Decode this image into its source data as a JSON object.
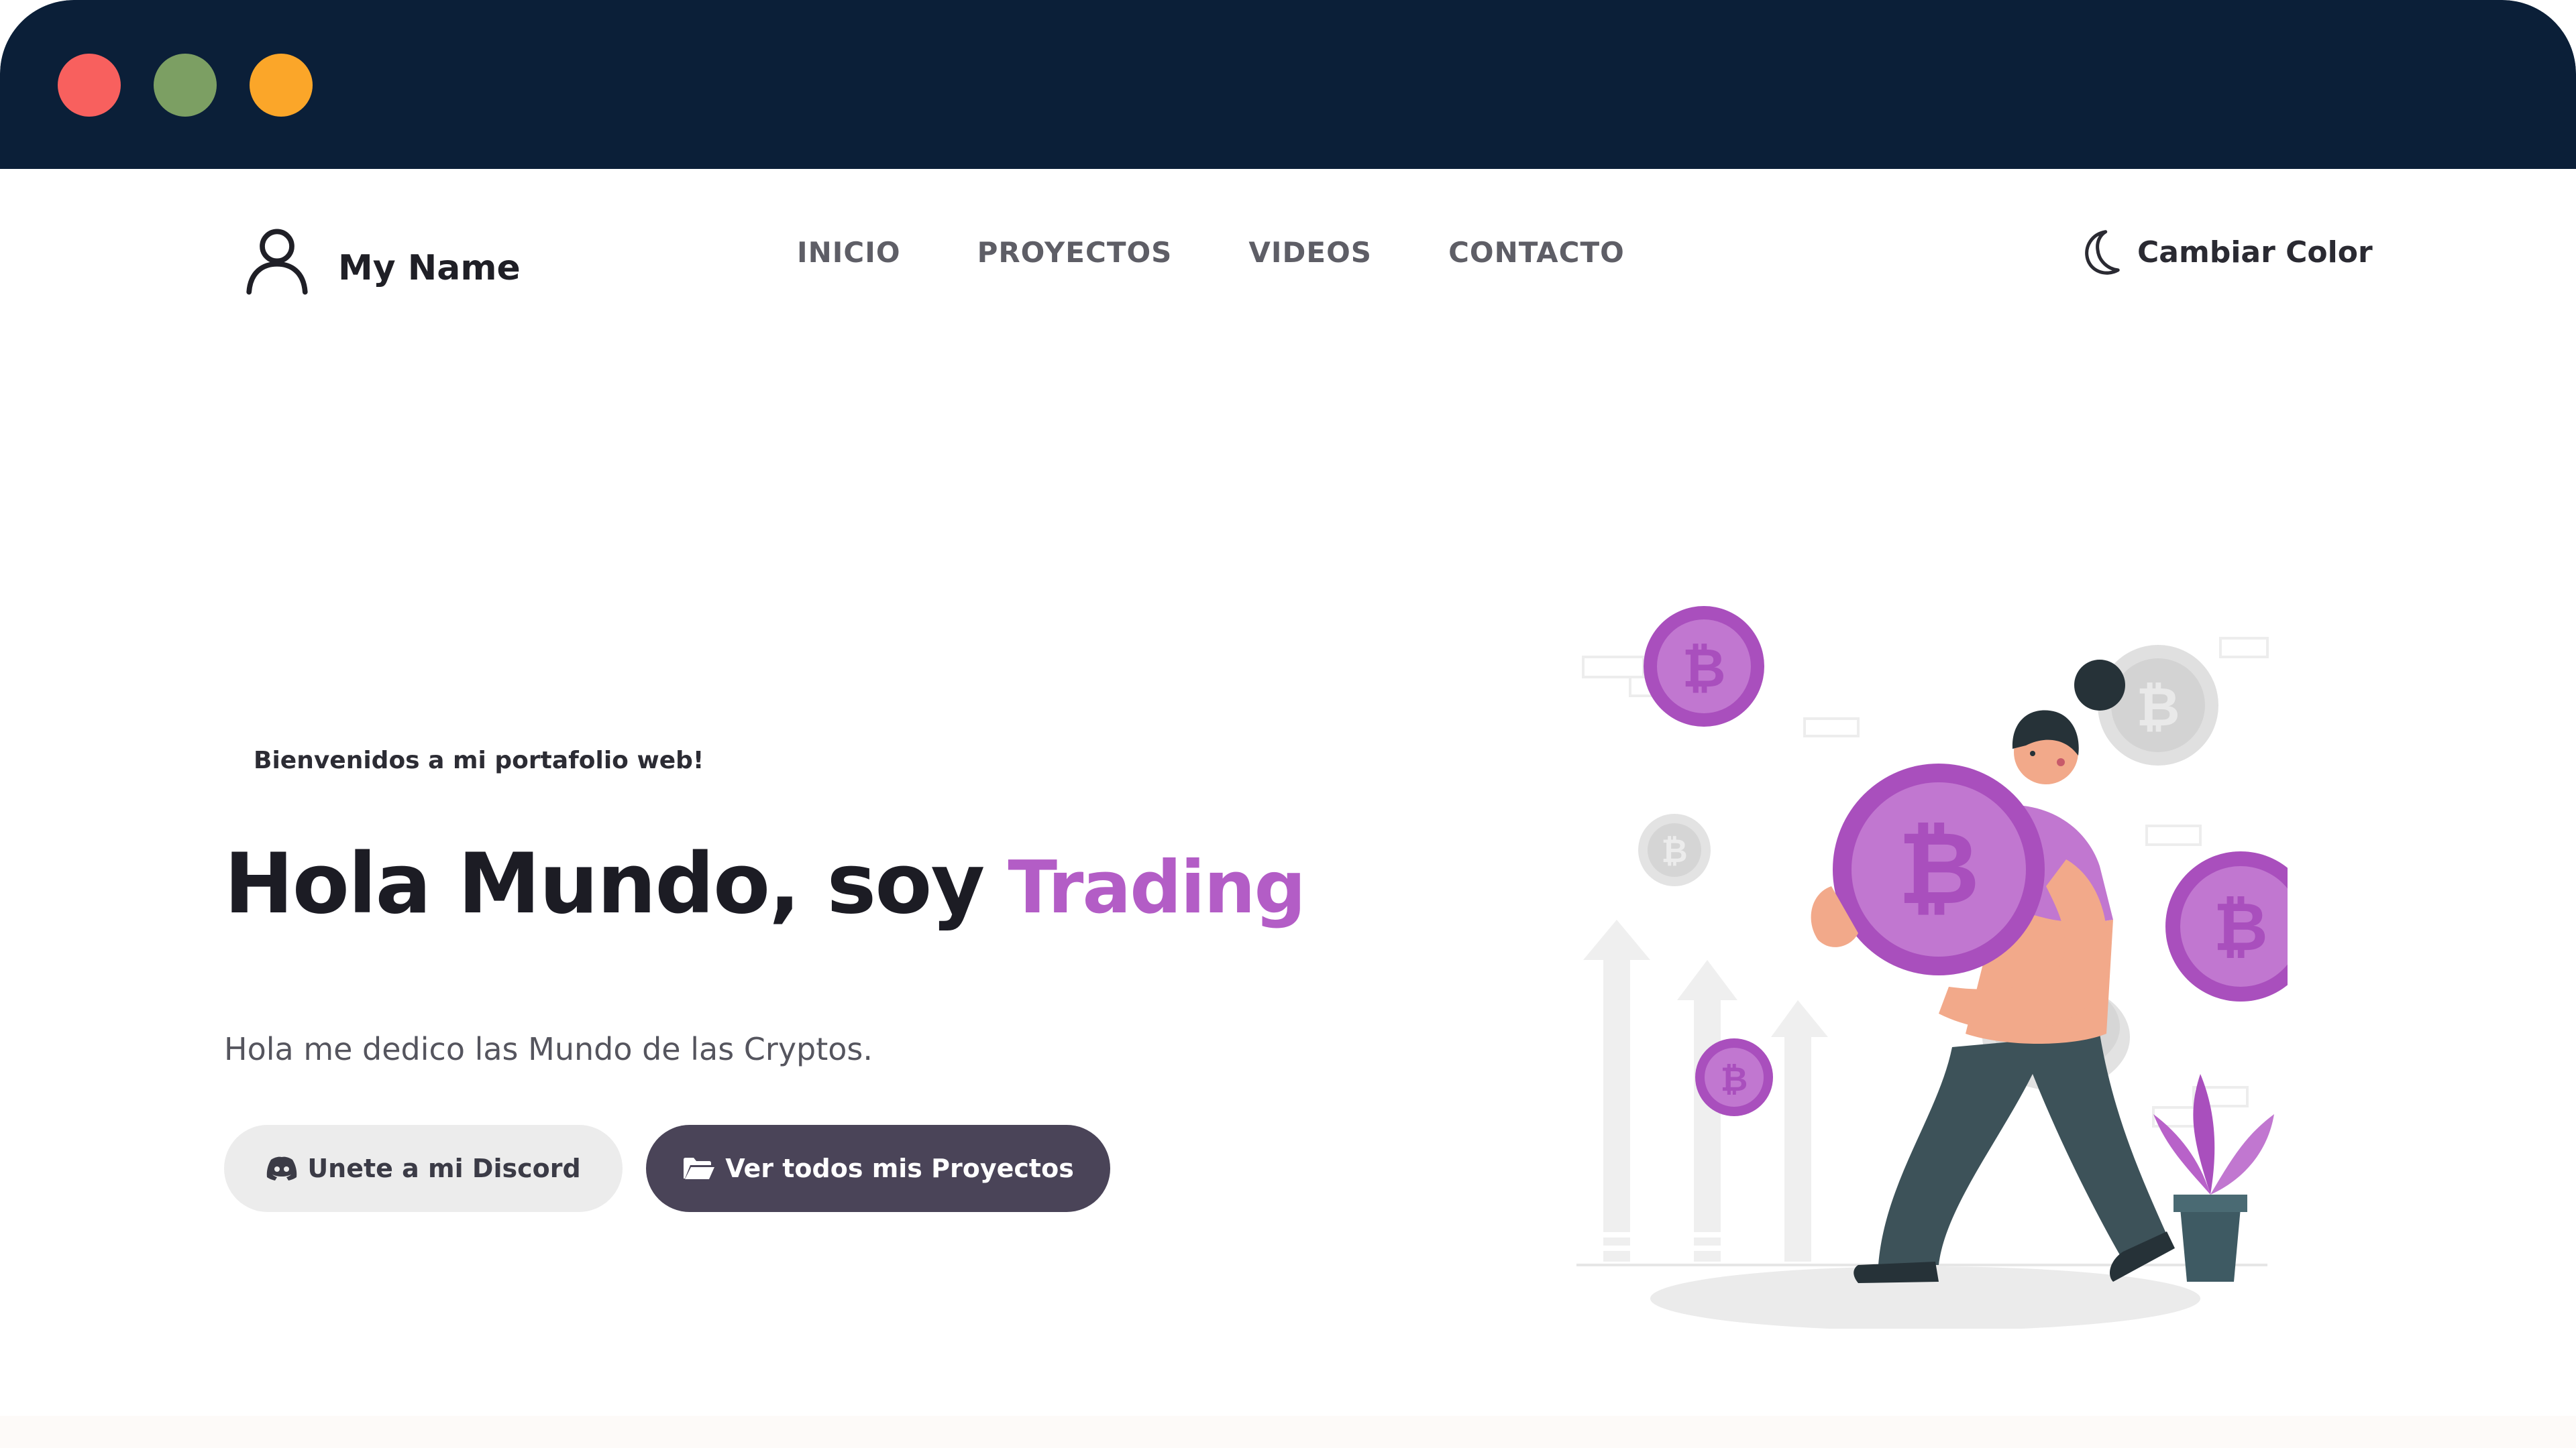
{
  "window": {
    "titlebar_color": "#0b1f38",
    "controls": [
      "close",
      "minimize",
      "maximize"
    ]
  },
  "header": {
    "brand_name": "My Name",
    "nav": [
      "INICIO",
      "PROYECTOS",
      "VIDEOS",
      "CONTACTO"
    ],
    "theme_toggle_label": "Cambiar Color"
  },
  "hero": {
    "welcome": "Bienvenidos a mi portafolio web!",
    "title": "Hola Mundo, soy",
    "title_accent": "Trading",
    "description": "Hola me dedico las Mundo de las Cryptos.",
    "discord_button": "Unete a mi Discord",
    "projects_button": "Ver todos mis Proyectos"
  },
  "colors": {
    "accent": "#b35dc6",
    "dark_button": "#4a4458",
    "light_button": "#ececec"
  },
  "icons": {
    "brand": "user-icon",
    "theme": "moon-icon",
    "discord": "discord-icon",
    "projects": "folder-open-icon"
  }
}
